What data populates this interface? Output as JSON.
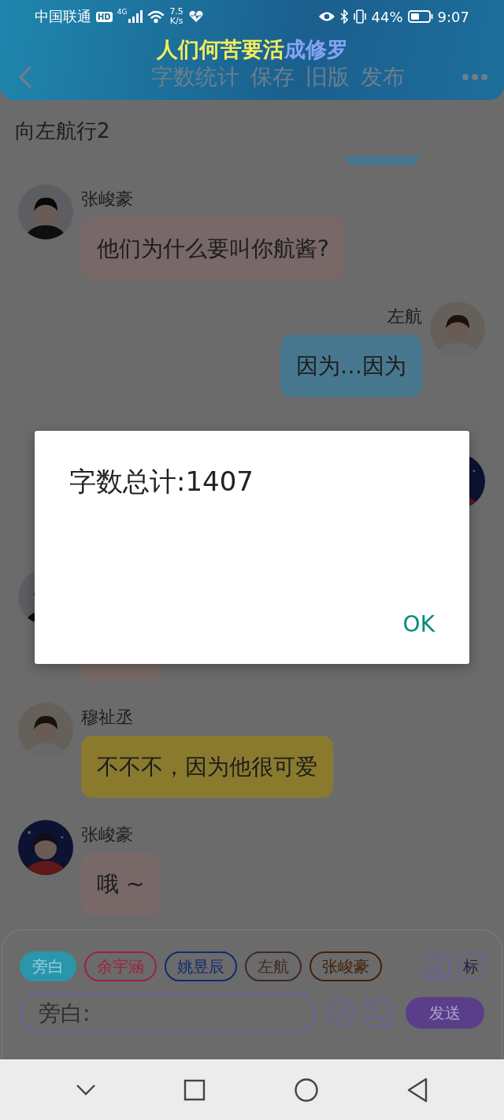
{
  "status_bar": {
    "carrier": "中国联通",
    "hd_badge": "HD",
    "network": "4G",
    "speed_value": "7.5",
    "speed_unit": "K/s",
    "battery_percent": "44%",
    "time": "9:07"
  },
  "header": {
    "title": [
      {
        "text": "人们何苦要活",
        "color": "#f4ee5c"
      },
      {
        "text": "成修罗",
        "color": "#86a4f4"
      }
    ],
    "actions": [
      "字数统计",
      "保存",
      "旧版",
      "发布"
    ]
  },
  "chapter_title": "向左航行2",
  "messages": [
    {
      "kind": "fragment",
      "color": "#487890"
    },
    {
      "kind": "left",
      "name": "张峻豪",
      "text": "他们为什么要叫你航酱?",
      "color": "#786868"
    },
    {
      "kind": "right",
      "name": "左航",
      "text": "因为…因为",
      "color": "#487890"
    },
    {
      "kind": "right"
    },
    {
      "kind": "left",
      "color": "#786868"
    },
    {
      "kind": "left",
      "name": "穆祉丞",
      "text": "不不不，因为他很可爱",
      "color": "#8a7a2e"
    },
    {
      "kind": "left",
      "name": "张峻豪",
      "text": "哦 ~",
      "color": "#786868"
    }
  ],
  "composer": {
    "roles": [
      {
        "label": "旁白",
        "selected": true,
        "color": "#2a96ac"
      },
      {
        "label": "余宇涵",
        "selected": false,
        "color": "#a02040"
      },
      {
        "label": "姚昱辰",
        "selected": false,
        "color": "#102a70"
      },
      {
        "label": "左航",
        "selected": false,
        "color": "#3e2a20"
      },
      {
        "label": "张峻豪",
        "selected": false,
        "color": "#44200a"
      }
    ],
    "tag_button": "标",
    "placeholder": "旁白:",
    "send": "发送"
  },
  "dialog": {
    "message": "字数总计:1407",
    "button": "OK"
  }
}
